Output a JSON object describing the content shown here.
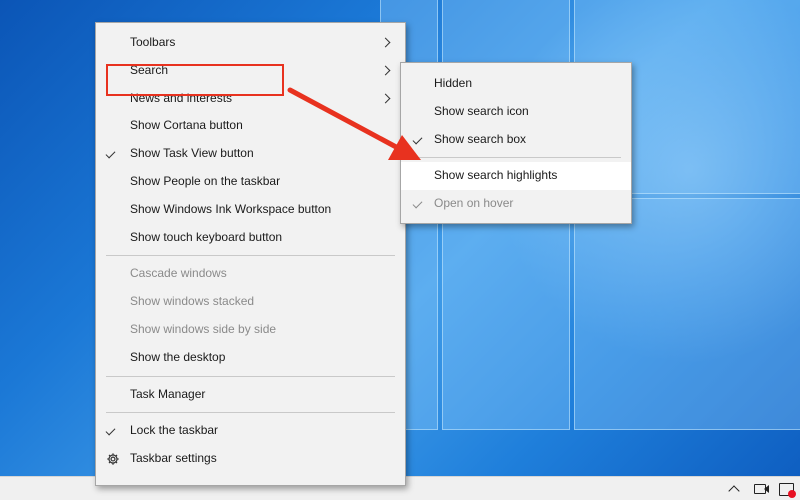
{
  "main_menu": {
    "items": [
      {
        "label": "Toolbars",
        "submenu": true
      },
      {
        "label": "Search",
        "submenu": true
      },
      {
        "label": "News and interests",
        "submenu": true
      },
      {
        "label": "Show Cortana button"
      },
      {
        "label": "Show Task View button",
        "checked": true
      },
      {
        "label": "Show People on the taskbar"
      },
      {
        "label": "Show Windows Ink Workspace button"
      },
      {
        "label": "Show touch keyboard button"
      },
      {
        "label": "Cascade windows",
        "disabled": true
      },
      {
        "label": "Show windows stacked",
        "disabled": true
      },
      {
        "label": "Show windows side by side",
        "disabled": true
      },
      {
        "label": "Show the desktop"
      },
      {
        "label": "Task Manager"
      },
      {
        "label": "Lock the taskbar",
        "checked": true
      },
      {
        "label": "Taskbar settings",
        "icon": "gear-icon"
      }
    ]
  },
  "search_submenu": {
    "items": [
      {
        "label": "Hidden"
      },
      {
        "label": "Show search icon"
      },
      {
        "label": "Show search box",
        "checked": true
      },
      {
        "label": "Show search highlights",
        "hovered": true
      },
      {
        "label": "Open on hover",
        "checked": true,
        "disabled": true
      }
    ]
  },
  "colors": {
    "annotation": "#e8321f",
    "menu_bg": "#f2f2f2",
    "desktop": "#1b78d6"
  },
  "tray": {
    "icons": [
      "chevron-up-icon",
      "camera-icon",
      "notification-icon"
    ]
  }
}
